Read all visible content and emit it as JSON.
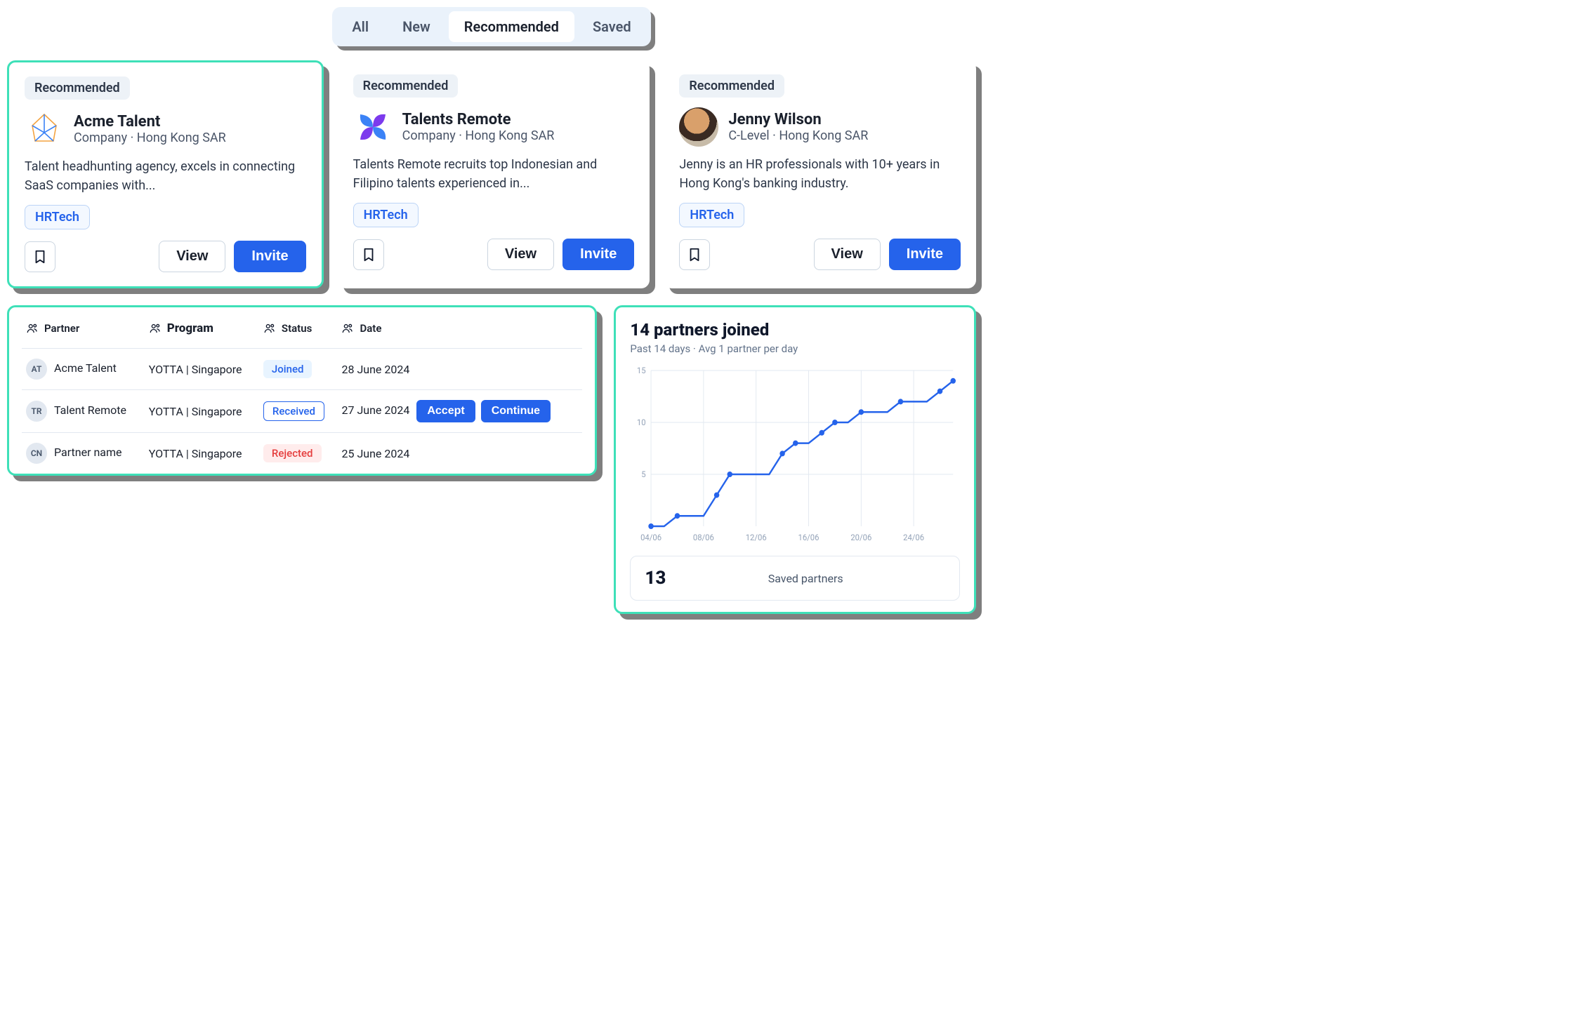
{
  "tabs": {
    "items": [
      "All",
      "New",
      "Recommended",
      "Saved"
    ],
    "active_index": 2
  },
  "cards": [
    {
      "badge": "Recommended",
      "name": "Acme Talent",
      "subtitle": "Company · Hong Kong SAR",
      "desc": "Talent headhunting agency, excels in connecting SaaS companies with...",
      "tag": "HRTech",
      "view": "View",
      "invite": "Invite",
      "highlight": true
    },
    {
      "badge": "Recommended",
      "name": "Talents Remote",
      "subtitle": "Company · Hong Kong SAR",
      "desc": "Talents Remote recruits top Indonesian and Filipino talents experienced in...",
      "tag": "HRTech",
      "view": "View",
      "invite": "Invite",
      "highlight": false
    },
    {
      "badge": "Recommended",
      "name": "Jenny Wilson",
      "subtitle": "C-Level · Hong Kong SAR",
      "desc": "Jenny is an HR professionals with 10+ years in Hong Kong's banking industry.",
      "tag": "HRTech",
      "view": "View",
      "invite": "Invite",
      "highlight": false
    }
  ],
  "table": {
    "headers": {
      "partner": "Partner",
      "program": "Program",
      "status": "Status",
      "date": "Date"
    },
    "rows": [
      {
        "initials": "AT",
        "partner": "Acme Talent",
        "program": "YOTTA | Singapore",
        "status": "Joined",
        "status_kind": "joined",
        "date": "28 June 2024",
        "actions": []
      },
      {
        "initials": "TR",
        "partner": "Talent Remote",
        "program": "YOTTA | Singapore",
        "status": "Received",
        "status_kind": "received",
        "date": "27 June 2024",
        "actions": [
          "Accept",
          "Continue"
        ]
      },
      {
        "initials": "CN",
        "partner": "Partner name",
        "program": "YOTTA | Singapore",
        "status": "Rejected",
        "status_kind": "rejected",
        "date": "25 June 2024",
        "actions": []
      }
    ]
  },
  "chart_data": {
    "type": "line",
    "title": "14 partners joined",
    "subtitle": "Past 14 days · Avg 1 partner per day",
    "xlabel": "",
    "ylabel": "",
    "ylim": [
      0,
      15
    ],
    "yticks": [
      5,
      10,
      15
    ],
    "xticks": [
      "04/06",
      "08/06",
      "12/06",
      "16/06",
      "20/06",
      "24/06"
    ],
    "x": [
      "04/06",
      "05/06",
      "06/06",
      "07/06",
      "08/06",
      "09/06",
      "10/06",
      "11/06",
      "12/06",
      "13/06",
      "14/06",
      "15/06",
      "16/06",
      "17/06",
      "18/06",
      "19/06",
      "20/06",
      "21/06",
      "22/06",
      "23/06",
      "24/06",
      "25/06",
      "26/06",
      "27/06"
    ],
    "values": [
      0,
      0,
      1,
      1,
      1,
      3,
      5,
      5,
      5,
      5,
      7,
      8,
      8,
      9,
      10,
      10,
      11,
      11,
      11,
      12,
      12,
      12,
      13,
      14
    ]
  },
  "stat": {
    "value": "13",
    "label": "Saved partners"
  }
}
